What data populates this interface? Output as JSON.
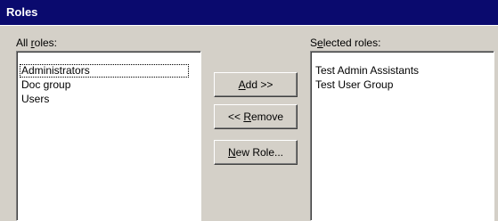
{
  "window": {
    "title": "Roles"
  },
  "all_roles": {
    "label_prefix": "All ",
    "label_accel": "r",
    "label_suffix": "oles:",
    "items": [
      "Administrators",
      "Doc group",
      "Users"
    ]
  },
  "selected_roles": {
    "label_prefix": "S",
    "label_accel": "e",
    "label_suffix": "lected roles:",
    "items": [
      "Test Admin Assistants",
      "Test User Group"
    ]
  },
  "buttons": {
    "add": {
      "accel": "A",
      "rest": "dd >>"
    },
    "remove": {
      "prefix": "<< ",
      "accel": "R",
      "rest": "emove"
    },
    "new_role": {
      "accel": "N",
      "rest": "ew Role..."
    }
  }
}
